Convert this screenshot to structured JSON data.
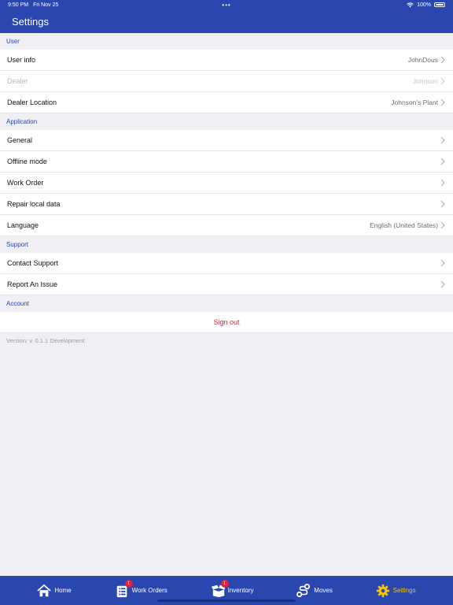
{
  "status": {
    "time": "9:50 PM",
    "date": "Fri Nov 25",
    "battery": "100%"
  },
  "nav": {
    "title": "Settings"
  },
  "sections": {
    "user": "User",
    "application": "Application",
    "support": "Support",
    "account": "Account"
  },
  "user_rows": {
    "user_info": {
      "label": "User info",
      "value": "JohnDous"
    },
    "dealer": {
      "label": "Dealer",
      "value": "Johnson"
    },
    "dealer_location": {
      "label": "Dealer Location",
      "value": "Johnson's Plant"
    }
  },
  "app_rows": {
    "general": "General",
    "offline": "Offline mode",
    "work_order": "Work Order",
    "repair": "Repair local data",
    "language": {
      "label": "Language",
      "value": "English (United States)"
    }
  },
  "support_rows": {
    "contact": "Contact Support",
    "report": "Report An Issue"
  },
  "account_rows": {
    "signout": "Sign out"
  },
  "version": "Version: v. 0.1.1 Development",
  "tabs": {
    "home": "Home",
    "work_orders": "Work Orders",
    "work_orders_badge": "1",
    "inventory": "Inventory",
    "inventory_badge": "1",
    "moves": "Moves",
    "settings": "Settings"
  },
  "colors": {
    "brand": "#2a47b0",
    "active_tab": "#f5c400",
    "danger": "#e0243c"
  }
}
